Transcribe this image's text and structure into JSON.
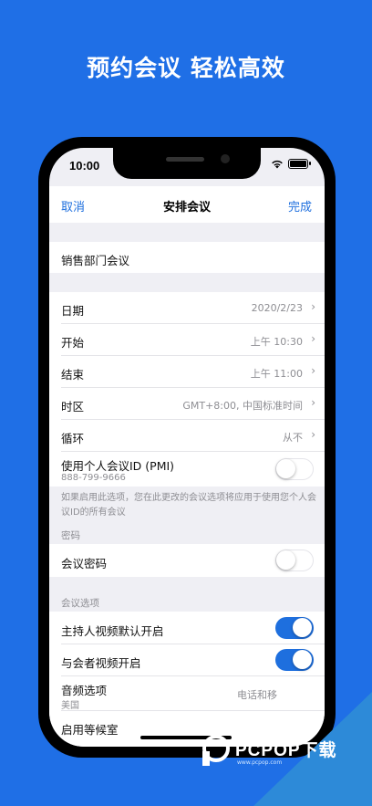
{
  "hero": {
    "title": "预约会议 轻松高效"
  },
  "status": {
    "time": "10:00"
  },
  "nav": {
    "cancel": "取消",
    "title": "安排会议",
    "done": "完成"
  },
  "topic": {
    "value": "销售部门会议"
  },
  "settings": {
    "date": {
      "label": "日期",
      "value": "2020/2/23"
    },
    "start": {
      "label": "开始",
      "value": "上午 10:30"
    },
    "end": {
      "label": "结束",
      "value": "上午 11:00"
    },
    "timezone": {
      "label": "时区",
      "value": "GMT+8:00, 中国标准时间"
    },
    "repeat": {
      "label": "循环",
      "value": "从不"
    },
    "pmi": {
      "label": "使用个人会议ID (PMI)",
      "sub": "888-799-9666",
      "enabled": false
    }
  },
  "pmi_note": "如果启用此选项，您在此更改的会议选项将应用于使用您个人会议ID的所有会议",
  "password_section": {
    "header": "密码",
    "label": "会议密码",
    "enabled": false
  },
  "options_section": {
    "header": "会议选项",
    "host_video": {
      "label": "主持人视频默认开启",
      "enabled": true
    },
    "participant_video": {
      "label": "与会者视频开启",
      "enabled": true
    },
    "audio": {
      "label": "音频选项",
      "sub": "美国",
      "value": "电话和移"
    },
    "waiting_room": {
      "label": "启用等候室"
    }
  },
  "watermark": {
    "text": "PCPOP下载",
    "sub": "www.pcpop.com"
  },
  "colors": {
    "background": "#1f6fe6",
    "accent": "#1e6fde"
  }
}
